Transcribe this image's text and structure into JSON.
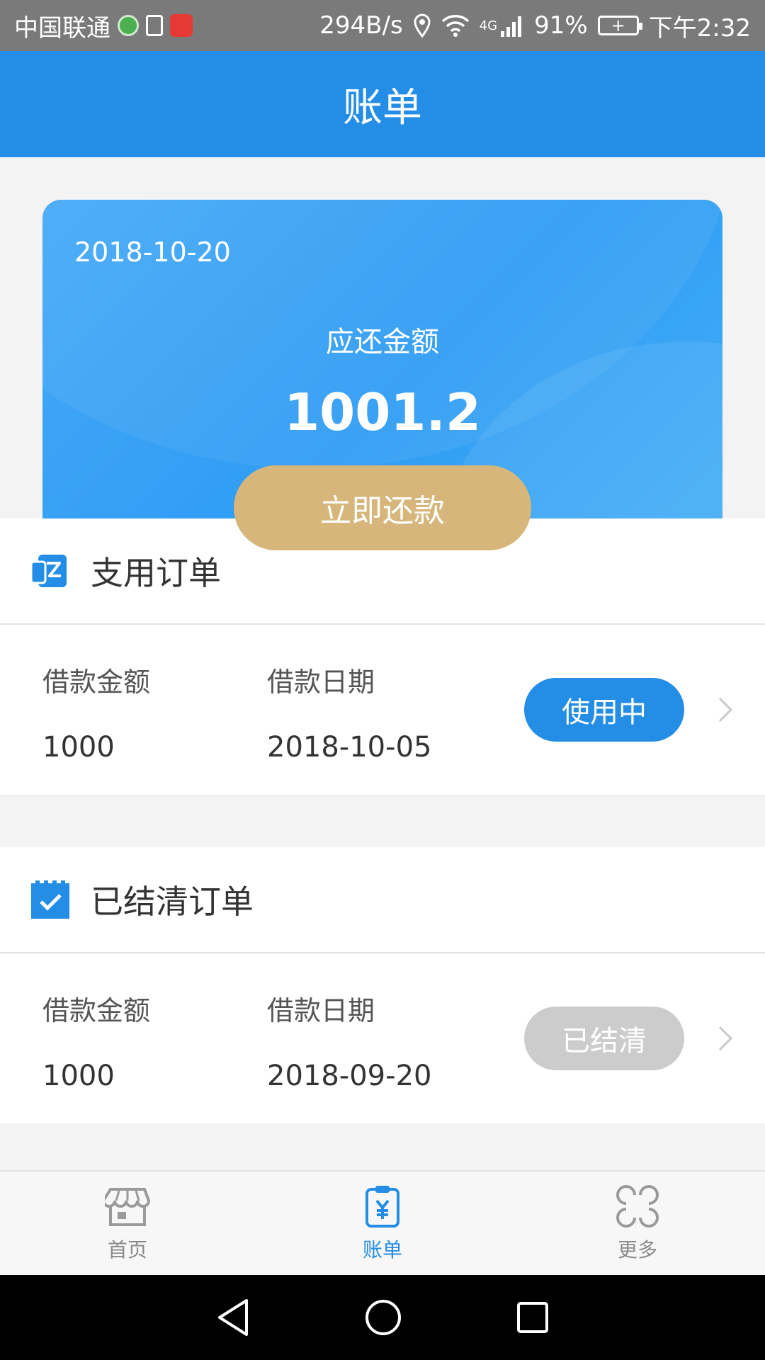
{
  "status_bar": {
    "carrier": "中国联通",
    "net_speed": "294B/s",
    "network": "4G",
    "battery": "91%",
    "time": "下午2:32"
  },
  "header": {
    "title": "账单"
  },
  "bill_card": {
    "date": "2018-10-20",
    "label": "应还金额",
    "amount": "1001.2",
    "pay_button": "立即还款"
  },
  "active_orders": {
    "title": "支用订单",
    "icon": "wallet-icon",
    "rows": [
      {
        "amount_label": "借款金额",
        "amount": "1000",
        "date_label": "借款日期",
        "date": "2018-10-05",
        "status": "使用中",
        "status_color": "#248de6"
      }
    ]
  },
  "settled_orders": {
    "title": "已结清订单",
    "icon": "calendar-check-icon",
    "rows": [
      {
        "amount_label": "借款金额",
        "amount": "1000",
        "date_label": "借款日期",
        "date": "2018-09-20",
        "status": "已结清",
        "status_color": "#cccccc"
      }
    ]
  },
  "bottom_nav": {
    "items": [
      {
        "label": "首页",
        "icon": "store-icon",
        "active": false
      },
      {
        "label": "账单",
        "icon": "bill-icon",
        "active": true
      },
      {
        "label": "更多",
        "icon": "more-icon",
        "active": false
      }
    ]
  },
  "colors": {
    "primary": "#248de6",
    "gold": "#d6b67a",
    "inactive": "#8a8a8a"
  }
}
